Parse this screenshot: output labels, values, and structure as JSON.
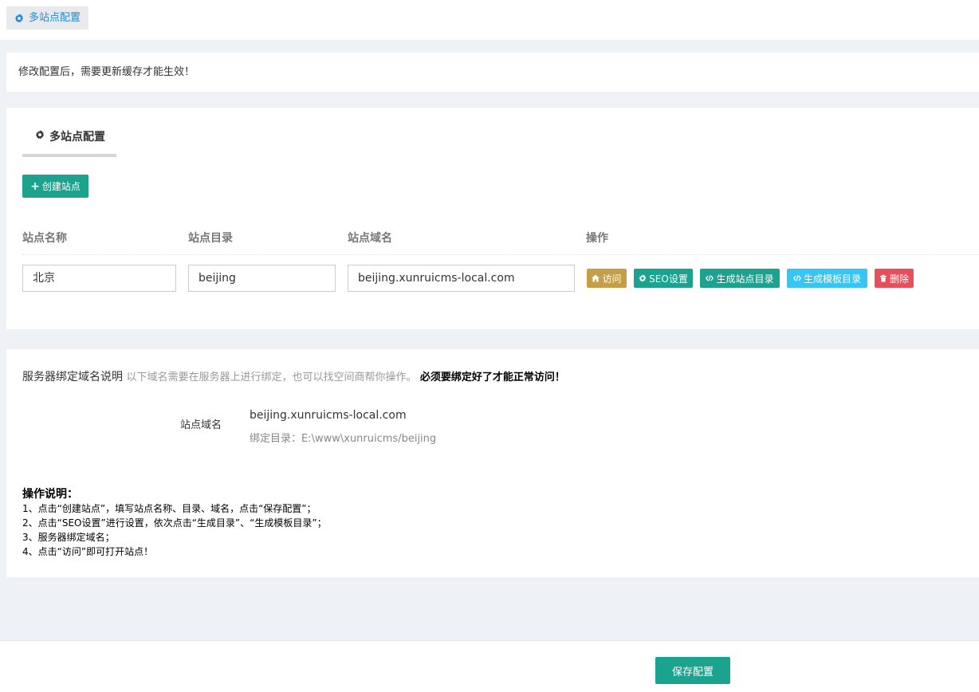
{
  "top_tab": {
    "label": "多站点配置",
    "icon": "gear-icon"
  },
  "notice": {
    "text": "修改配置后，需要更新缓存才能生效！"
  },
  "panel": {
    "tab_label": "多站点配置",
    "create_button": "创建站点",
    "columns": [
      "站点名称",
      "站点目录",
      "站点域名",
      "操作"
    ],
    "row": {
      "name": "北京",
      "dir": "beijing",
      "domain": "beijing.xunruicms-local.com"
    },
    "actions": [
      {
        "label": "访问",
        "icon": "home-icon",
        "color": "#c49f47"
      },
      {
        "label": "SEO设置",
        "icon": "gear-icon",
        "color": "#1ba38f"
      },
      {
        "label": "生成站点目录",
        "icon": "code-icon",
        "color": "#1ba38f"
      },
      {
        "label": "生成模板目录",
        "icon": "code-icon",
        "color": "#36c6f4"
      },
      {
        "label": "删除",
        "icon": "trash-icon",
        "color": "#e7505a"
      }
    ]
  },
  "binding": {
    "title": "服务器绑定域名说明",
    "hint": "以下域名需要在服务器上进行绑定，也可以找空间商帮你操作。",
    "warning": "必须要绑定好了才能正常访问！",
    "label": "站点域名",
    "domain": "beijing.xunruicms-local.com",
    "dir": "绑定目录：E:\\www\\xunruicms/beijing"
  },
  "instructions": {
    "title": "操作说明：",
    "lines": [
      "1、点击“创建站点”，填写站点名称、目录、域名，点击“保存配置”；",
      "2、点击“SEO设置”进行设置，依次点击“生成目录”、“生成模板目录”；",
      "3、服务器绑定域名；",
      "4、点击“访问”即可打开站点！"
    ]
  },
  "footer": {
    "save_button": "保存配置"
  }
}
